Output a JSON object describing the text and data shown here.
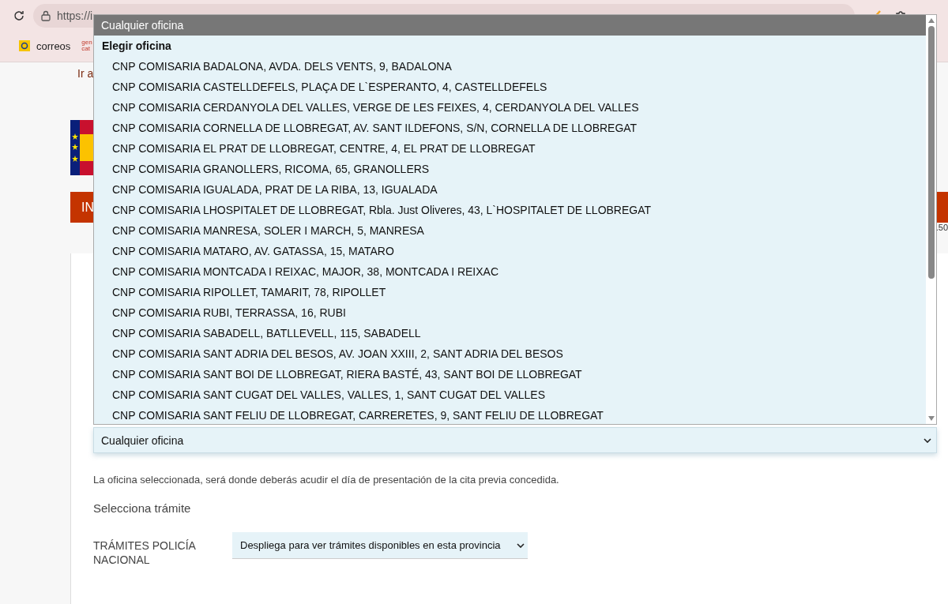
{
  "browser": {
    "url": "https://i",
    "bookmarks": [
      {
        "kind": "correos",
        "label": "correos"
      },
      {
        "kind": "gencat",
        "label": "gen cat"
      }
    ]
  },
  "page": {
    "skip_link": "Ir a",
    "banner_text": "IN",
    "side_text": ".50"
  },
  "dropdown": {
    "options": [
      {
        "label": "Cualquier oficina",
        "selected": true
      }
    ],
    "group": {
      "label": "Elegir oficina",
      "options": [
        {
          "label": "CNP COMISARIA BADALONA, AVDA. DELS VENTS, 9, BADALONA",
          "selected": false
        },
        {
          "label": "CNP COMISARIA CASTELLDEFELS, PLAÇA DE L`ESPERANTO, 4, CASTELLDEFELS",
          "selected": false
        },
        {
          "label": "CNP COMISARIA CERDANYOLA DEL VALLES, VERGE DE LES FEIXES, 4, CERDANYOLA DEL VALLES",
          "selected": false
        },
        {
          "label": "CNP COMISARIA CORNELLA DE LLOBREGAT, AV. SANT ILDEFONS, S/N, CORNELLA DE LLOBREGAT",
          "selected": false
        },
        {
          "label": "CNP COMISARIA EL PRAT DE LLOBREGAT, CENTRE, 4, EL PRAT DE LLOBREGAT",
          "selected": false
        },
        {
          "label": "CNP COMISARIA GRANOLLERS, RICOMA, 65, GRANOLLERS",
          "selected": false
        },
        {
          "label": "CNP COMISARIA IGUALADA, PRAT DE LA RIBA, 13, IGUALADA",
          "selected": false
        },
        {
          "label": "CNP COMISARIA LHOSPITALET DE LLOBREGAT, Rbla. Just Oliveres, 43, L`HOSPITALET DE LLOBREGAT",
          "selected": false
        },
        {
          "label": "CNP COMISARIA MANRESA, SOLER I MARCH, 5, MANRESA",
          "selected": false
        },
        {
          "label": "CNP COMISARIA MATARO, AV. GATASSA, 15, MATARO",
          "selected": false
        },
        {
          "label": "CNP COMISARIA MONTCADA I REIXAC, MAJOR, 38, MONTCADA I REIXAC",
          "selected": false
        },
        {
          "label": "CNP COMISARIA RIPOLLET, TAMARIT, 78, RIPOLLET",
          "selected": false
        },
        {
          "label": "CNP COMISARIA RUBI, TERRASSA, 16, RUBI",
          "selected": false
        },
        {
          "label": "CNP COMISARIA SABADELL, BATLLEVELL, 115, SABADELL",
          "selected": false
        },
        {
          "label": "CNP COMISARIA SANT ADRIA DEL BESOS, AV. JOAN XXIII, 2, SANT ADRIA DEL BESOS",
          "selected": false
        },
        {
          "label": "CNP COMISARIA SANT BOI DE LLOBREGAT, RIERA BASTÉ, 43, SANT BOI DE LLOBREGAT",
          "selected": false
        },
        {
          "label": "CNP COMISARIA SANT CUGAT DEL VALLES, VALLES, 1, SANT CUGAT DEL VALLES",
          "selected": false
        },
        {
          "label": "CNP COMISARIA SANT FELIU DE LLOBREGAT, CARRERETES, 9, SANT FELIU DE LLOBREGAT",
          "selected": false
        }
      ]
    }
  },
  "office_select": {
    "value": "Cualquier oficina"
  },
  "note": "La oficina seleccionada, será donde deberás acudir el día de presentación de la cita previa concedida.",
  "section_title": "Selecciona trámite",
  "tramite": {
    "label": "TRÁMITES POLICÍA NACIONAL",
    "value": "Despliega para ver trámites disponibles en esta provincia"
  }
}
